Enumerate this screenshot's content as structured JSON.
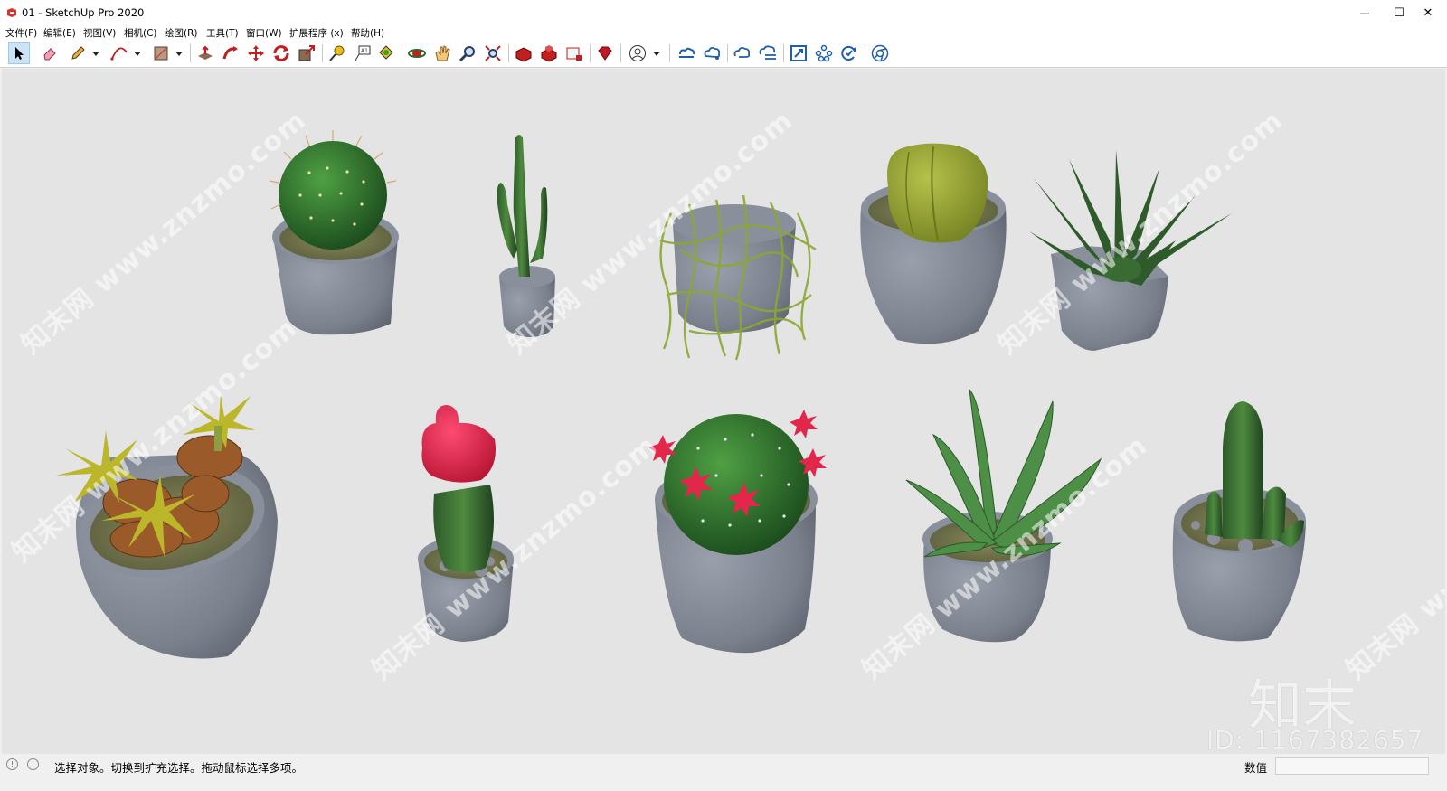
{
  "window": {
    "title": "01 - SketchUp Pro 2020",
    "minimize_glyph": "—",
    "maximize_glyph": "☐",
    "close_glyph": "✕"
  },
  "menu": {
    "items": [
      "文件(F)",
      "编辑(E)",
      "视图(V)",
      "相机(C)",
      "绘图(R)",
      "工具(T)",
      "窗口(W)",
      "扩展程序 (x)",
      "帮助(H)"
    ]
  },
  "toolbar": {
    "tools": [
      "select-icon",
      "eraser-icon",
      "pencil-icon",
      "arc-icon",
      "rectangle-icon",
      "push-pull-icon",
      "follow-me-icon",
      "move-icon",
      "rotate-icon",
      "scale-icon",
      "tape-measure-icon",
      "text-icon",
      "paint-bucket-icon",
      "orbit-icon",
      "pan-icon",
      "zoom-icon",
      "zoom-extents-icon",
      "3d-warehouse-icon",
      "extension-warehouse-icon",
      "layout-icon",
      "ruby-icon",
      "account-icon",
      "trimble-connect-icon",
      "cloud-share-icon",
      "cloud-sync-icon",
      "cloud-list-icon",
      "section-icon",
      "components-icon",
      "update-icon",
      "chrome-icon"
    ]
  },
  "viewport": {
    "background": "#e4e4e4",
    "watermark_text": "知末网 www.znzmo.com",
    "logo_text": "知末",
    "id_text": "ID: 1167382657"
  },
  "statusbar": {
    "text": "选择对象。切换到扩充选择。拖动鼠标选择多项。",
    "value_label": "数值",
    "value": ""
  },
  "colors": {
    "pot": "#7e838f",
    "cactus_green": "#3d7a35",
    "flower_red": "#e2274b"
  }
}
